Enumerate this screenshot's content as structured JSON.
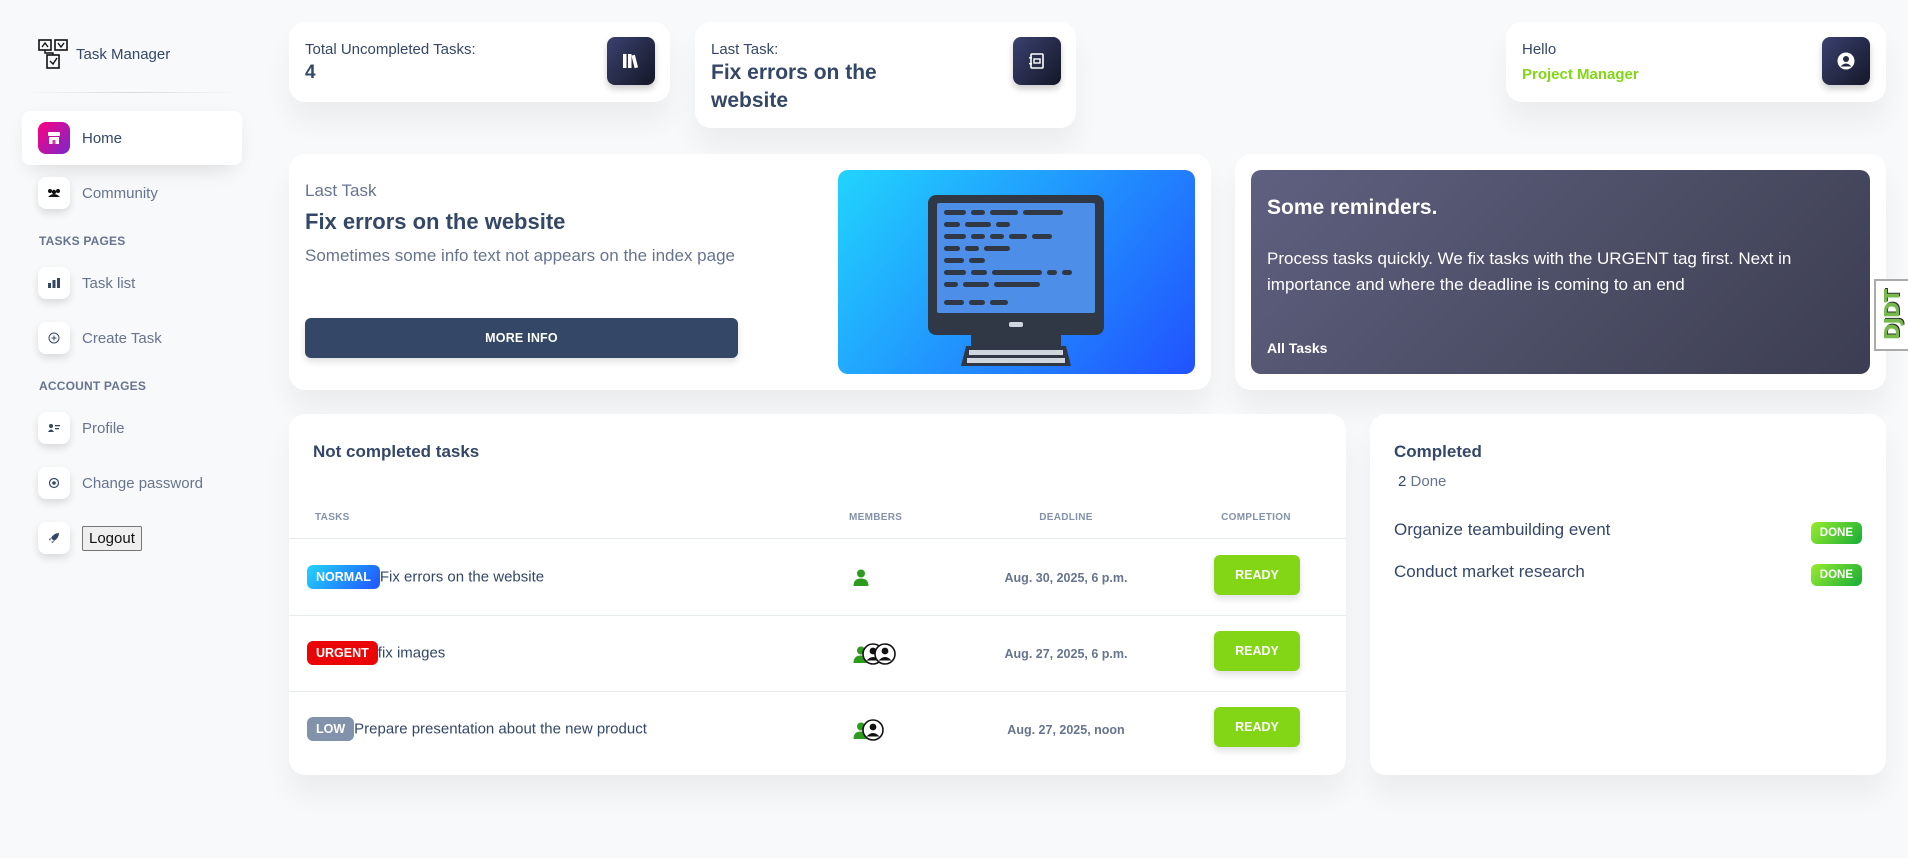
{
  "brand": {
    "name": "Task Manager"
  },
  "sidebar": {
    "items": [
      {
        "label": "Home"
      },
      {
        "label": "Community"
      }
    ],
    "tasks_section": "TASKS PAGES",
    "task_items": [
      {
        "label": "Task list"
      },
      {
        "label": "Create Task"
      }
    ],
    "account_section": "ACCOUNT PAGES",
    "account_items": [
      {
        "label": "Profile"
      },
      {
        "label": "Change password"
      }
    ],
    "logout_label": "Logout"
  },
  "stats": {
    "uncompleted_label": "Total Uncompleted Tasks:",
    "uncompleted_value": "4",
    "last_task_label": "Last Task:",
    "last_task_value": "Fix errors on the website",
    "hello_label": "Hello",
    "role": "Project Manager"
  },
  "last_task_card": {
    "label": "Last Task",
    "title": "Fix errors on the website",
    "description": "Sometimes some info text not appears on the index page",
    "button": "MORE INFO"
  },
  "reminders": {
    "title": "Some reminders.",
    "text": "Process tasks quickly. We fix tasks with the URGENT tag first. Next in importance and where the deadline is coming to an end",
    "link": "All Tasks"
  },
  "tasks_table": {
    "title": "Not completed tasks",
    "columns": [
      "TASKS",
      "MEMBERS",
      "DEADLINE",
      "COMPLETION"
    ],
    "rows": [
      {
        "tag": "NORMAL",
        "name": "Fix errors on the website",
        "deadline": "Aug. 30, 2025, 6 p.m.",
        "action": "READY"
      },
      {
        "tag": "URGENT",
        "name": "fix images",
        "deadline": "Aug. 27, 2025, 6 p.m.",
        "action": "READY"
      },
      {
        "tag": "LOW",
        "name": "Prepare presentation about the new product",
        "deadline": "Aug. 27, 2025, noon",
        "action": "READY"
      }
    ]
  },
  "completed": {
    "title": "Completed",
    "count": "2",
    "count_suffix": "Done",
    "items": [
      {
        "name": "Organize teambuilding event",
        "badge": "DONE"
      },
      {
        "name": "Conduct market research",
        "badge": "DONE"
      }
    ]
  },
  "debug_toolbar": {
    "label": "DJDT"
  },
  "colors": {
    "primary_text": "#344767",
    "secondary_text": "#67748e",
    "success": "#82d616",
    "urgent": "#ea0606",
    "dark": "#344767"
  }
}
